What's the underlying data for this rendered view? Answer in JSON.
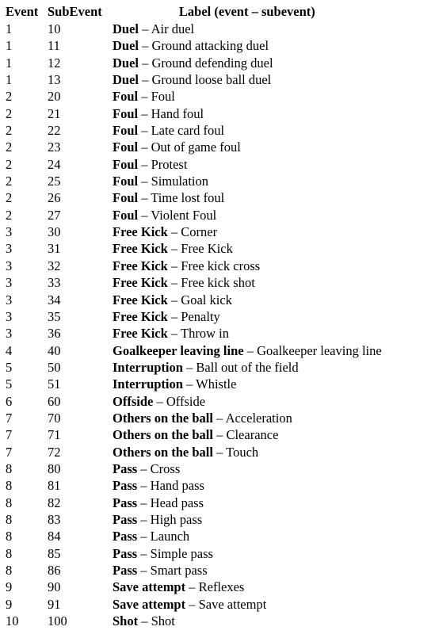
{
  "table": {
    "headers": {
      "event": "Event",
      "subevent": "SubEvent",
      "label": "Label (event – subevent)"
    },
    "separator": " – ",
    "rows": [
      {
        "event": "1",
        "subevent": "10",
        "event_name": "Duel",
        "subevent_name": "Air duel"
      },
      {
        "event": "1",
        "subevent": "11",
        "event_name": "Duel",
        "subevent_name": "Ground attacking duel"
      },
      {
        "event": "1",
        "subevent": "12",
        "event_name": "Duel",
        "subevent_name": "Ground defending duel"
      },
      {
        "event": "1",
        "subevent": "13",
        "event_name": "Duel",
        "subevent_name": "Ground loose ball duel"
      },
      {
        "event": "2",
        "subevent": "20",
        "event_name": "Foul",
        "subevent_name": "Foul"
      },
      {
        "event": "2",
        "subevent": "21",
        "event_name": "Foul",
        "subevent_name": "Hand foul"
      },
      {
        "event": "2",
        "subevent": "22",
        "event_name": "Foul",
        "subevent_name": "Late card foul"
      },
      {
        "event": "2",
        "subevent": "23",
        "event_name": "Foul",
        "subevent_name": "Out of game foul"
      },
      {
        "event": "2",
        "subevent": "24",
        "event_name": "Foul",
        "subevent_name": "Protest"
      },
      {
        "event": "2",
        "subevent": "25",
        "event_name": "Foul",
        "subevent_name": "Simulation"
      },
      {
        "event": "2",
        "subevent": "26",
        "event_name": "Foul",
        "subevent_name": "Time lost foul"
      },
      {
        "event": "2",
        "subevent": "27",
        "event_name": "Foul",
        "subevent_name": "Violent Foul"
      },
      {
        "event": "3",
        "subevent": "30",
        "event_name": "Free Kick",
        "subevent_name": "Corner"
      },
      {
        "event": "3",
        "subevent": "31",
        "event_name": "Free Kick",
        "subevent_name": "Free Kick"
      },
      {
        "event": "3",
        "subevent": "32",
        "event_name": "Free Kick",
        "subevent_name": "Free kick cross"
      },
      {
        "event": "3",
        "subevent": "33",
        "event_name": "Free Kick",
        "subevent_name": "Free kick shot"
      },
      {
        "event": "3",
        "subevent": "34",
        "event_name": "Free Kick",
        "subevent_name": "Goal kick"
      },
      {
        "event": "3",
        "subevent": "35",
        "event_name": "Free Kick",
        "subevent_name": "Penalty"
      },
      {
        "event": "3",
        "subevent": "36",
        "event_name": "Free Kick",
        "subevent_name": "Throw in"
      },
      {
        "event": "4",
        "subevent": "40",
        "event_name": "Goalkeeper leaving line",
        "subevent_name": "Goalkeeper leaving line"
      },
      {
        "event": "5",
        "subevent": "50",
        "event_name": "Interruption",
        "subevent_name": "Ball out of the field"
      },
      {
        "event": "5",
        "subevent": "51",
        "event_name": "Interruption",
        "subevent_name": "Whistle"
      },
      {
        "event": "6",
        "subevent": "60",
        "event_name": "Offside",
        "subevent_name": "Offside"
      },
      {
        "event": "7",
        "subevent": "70",
        "event_name": "Others on the ball",
        "subevent_name": "Acceleration"
      },
      {
        "event": "7",
        "subevent": "71",
        "event_name": "Others on the ball",
        "subevent_name": "Clearance"
      },
      {
        "event": "7",
        "subevent": "72",
        "event_name": "Others on the ball",
        "subevent_name": "Touch"
      },
      {
        "event": "8",
        "subevent": "80",
        "event_name": "Pass",
        "subevent_name": "Cross"
      },
      {
        "event": "8",
        "subevent": "81",
        "event_name": "Pass",
        "subevent_name": "Hand pass"
      },
      {
        "event": "8",
        "subevent": "82",
        "event_name": "Pass",
        "subevent_name": "Head pass"
      },
      {
        "event": "8",
        "subevent": "83",
        "event_name": "Pass",
        "subevent_name": "High pass"
      },
      {
        "event": "8",
        "subevent": "84",
        "event_name": "Pass",
        "subevent_name": "Launch"
      },
      {
        "event": "8",
        "subevent": "85",
        "event_name": "Pass",
        "subevent_name": "Simple pass"
      },
      {
        "event": "8",
        "subevent": "86",
        "event_name": "Pass",
        "subevent_name": "Smart pass"
      },
      {
        "event": "9",
        "subevent": "90",
        "event_name": "Save attempt",
        "subevent_name": "Reflexes"
      },
      {
        "event": "9",
        "subevent": "91",
        "event_name": "Save attempt",
        "subevent_name": "Save attempt"
      },
      {
        "event": "10",
        "subevent": "100",
        "event_name": "Shot",
        "subevent_name": "Shot"
      }
    ]
  }
}
